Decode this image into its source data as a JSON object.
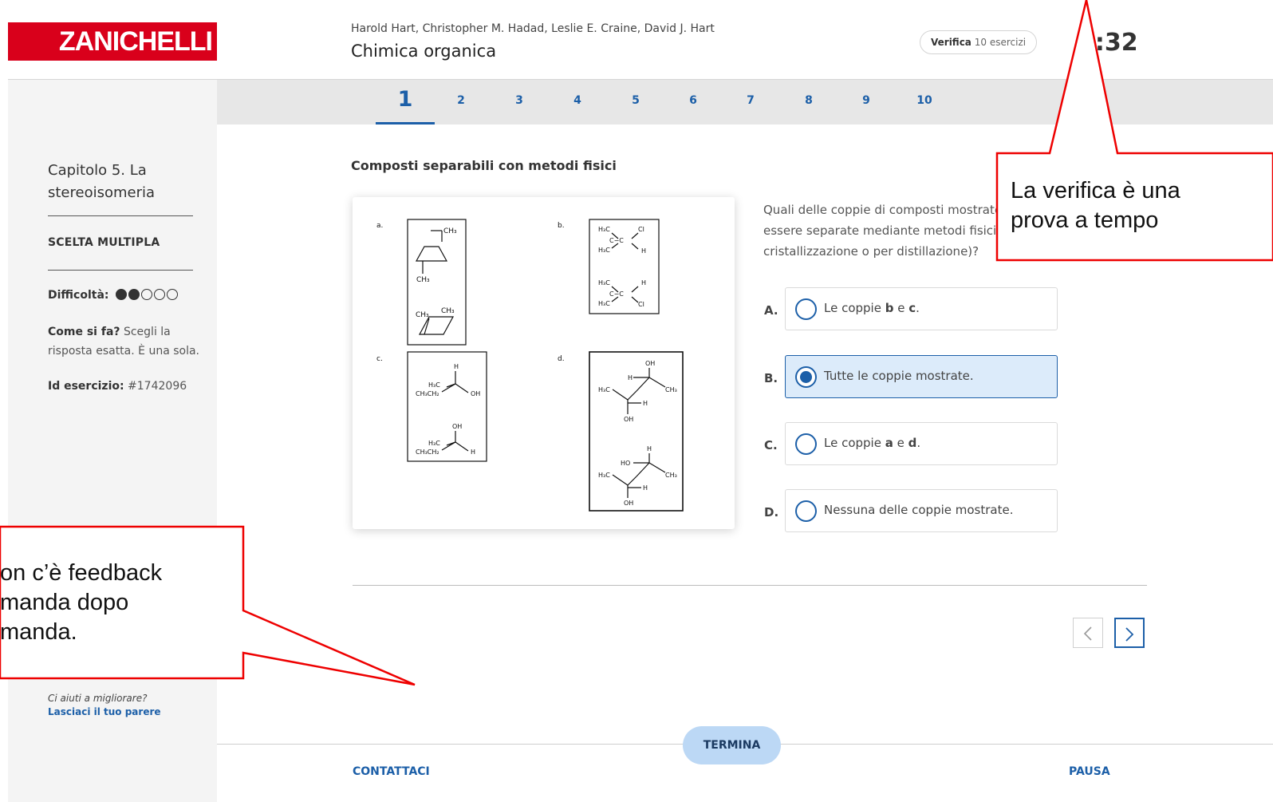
{
  "header": {
    "logo": "ZANICHELLI",
    "authors": "Harold Hart, Christopher M. Hadad, Leslie E. Craine, David J. Hart",
    "book_title": "Chimica organica",
    "verify_label": "Verifica",
    "verify_count": "10 esercizi",
    "timer": "9:32"
  },
  "tabs": [
    "1",
    "2",
    "3",
    "4",
    "5",
    "6",
    "7",
    "8",
    "9",
    "10"
  ],
  "sidebar": {
    "chapter": "Capitolo 5. La stereoisomeria",
    "type": "SCELTA MULTIPLA",
    "difficulty_label": "Difficoltà:",
    "difficulty_level": 2,
    "difficulty_max": 5,
    "howto_label": "Come si fa?",
    "howto_text": "Scegli la risposta esatta. È una sola.",
    "id_label": "Id esercizio:",
    "id_value": "#1742096",
    "feedback_ask": "Ci aiuti a migliorare?",
    "feedback_link": "Lasciaci il tuo parere"
  },
  "exercise": {
    "title": "Composti separabili con metodi fisici",
    "question": "Quali delle coppie di composti mostrate possono essere separate mediante metodi fisici (per cristallizzazione o per distillazione)?",
    "figure_labels": [
      "a.",
      "b.",
      "c.",
      "d."
    ],
    "options": [
      {
        "letter": "A.",
        "text_before": "Le coppie ",
        "b1": "b",
        "mid": " e ",
        "b2": "c",
        "after": ".",
        "selected": false
      },
      {
        "letter": "B.",
        "text_before": "Tutte le coppie mostrate.",
        "b1": "",
        "mid": "",
        "b2": "",
        "after": "",
        "selected": true
      },
      {
        "letter": "C.",
        "text_before": "Le coppie ",
        "b1": "a",
        "mid": " e ",
        "b2": "d",
        "after": ".",
        "selected": false
      },
      {
        "letter": "D.",
        "text_before": "Nessuna delle coppie mostrate.",
        "b1": "",
        "mid": "",
        "b2": "",
        "after": "",
        "selected": false
      }
    ]
  },
  "footer": {
    "termina": "TERMINA",
    "contattaci": "CONTATTACI",
    "pausa": "PAUSA"
  },
  "callouts": {
    "timer_note": [
      "La verifica è una",
      "prova a tempo"
    ],
    "feedback_note": [
      "on c’è feedback",
      "manda dopo",
      "manda."
    ]
  },
  "colors": {
    "brand_red": "#d9001b",
    "accent_blue": "#1c5fa8",
    "callout_border": "#ff0000"
  }
}
